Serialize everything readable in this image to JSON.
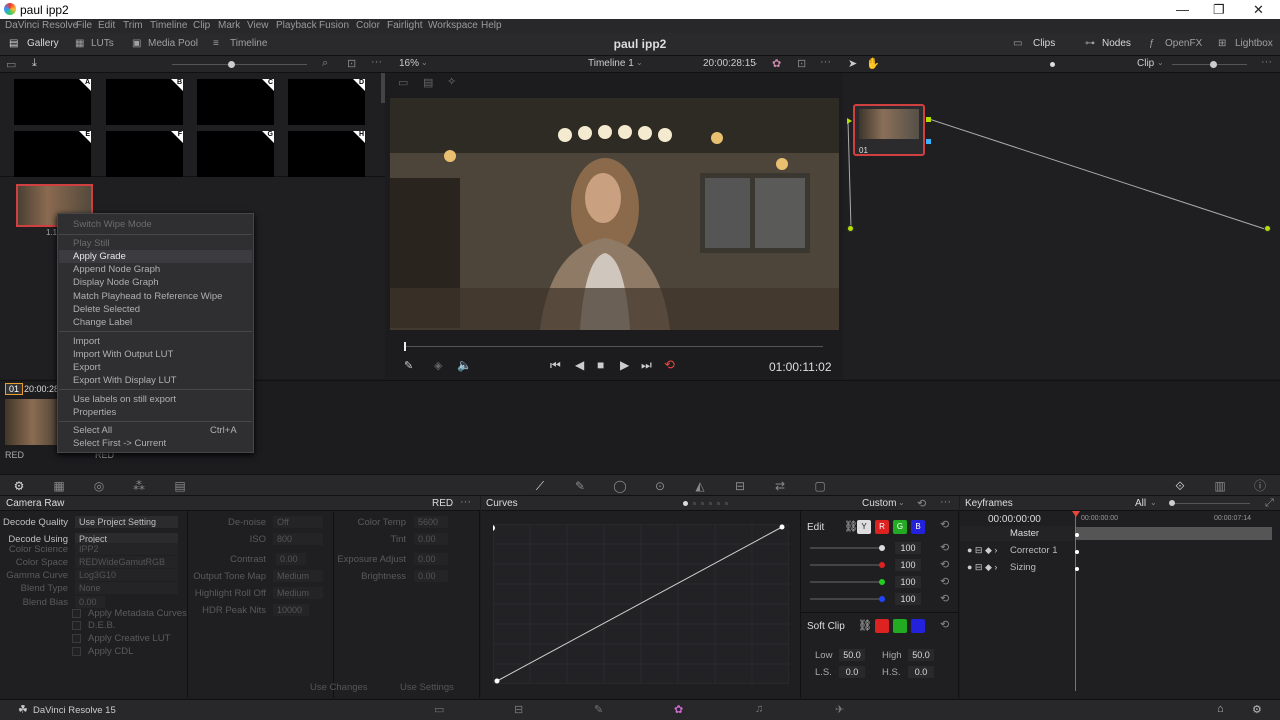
{
  "window": {
    "title": "paul ipp2",
    "min": "—",
    "max": "❐",
    "close": "✕"
  },
  "menu": [
    "DaVinci Resolve",
    "File",
    "Edit",
    "Trim",
    "Timeline",
    "Clip",
    "Mark",
    "View",
    "Playback",
    "Fusion",
    "Color",
    "Fairlight",
    "Workspace",
    "Help"
  ],
  "toolbar": {
    "gallery": "Gallery",
    "luts": "LUTs",
    "media_pool": "Media Pool",
    "timeline": "Timeline",
    "project_title": "paul ipp2",
    "clips": "Clips",
    "nodes": "Nodes",
    "openfx": "OpenFX",
    "lightbox": "Lightbox"
  },
  "bar2": {
    "zoom": "16%",
    "timeline_name": "Timeline 1",
    "timecode": "20:00:28:15",
    "clip_mode": "Clip"
  },
  "gallery": {
    "still_labels": [
      "A",
      "B",
      "C",
      "D",
      "E",
      "F",
      "G",
      "H"
    ],
    "still_id": "1.1"
  },
  "context_menu": {
    "items": [
      "Switch Wipe Mode",
      "Play Still",
      "Apply Grade",
      "Append Node Graph",
      "Display Node Graph",
      "Match Playhead to Reference Wipe",
      "Delete Selected",
      "Change Label",
      "Import",
      "Import With Output LUT",
      "Export",
      "Export With Display LUT",
      "Use labels on still export",
      "Properties",
      "Select All",
      "Select First -> Current"
    ],
    "shortcut_select_all": "Ctrl+A"
  },
  "viewer": {
    "timecode": "01:00:11:02"
  },
  "node": {
    "label": "01"
  },
  "clip_strip": {
    "clip_num": "01",
    "clip_tc": "20:00:28",
    "codec1": "RED",
    "codec2": "RED"
  },
  "camera_raw": {
    "title": "Camera Raw",
    "badge": "RED",
    "left": [
      {
        "label": "Decode Quality",
        "value": "Use Project Setting"
      },
      {
        "label": "Decode Using",
        "value": "Project"
      },
      {
        "label": "Color Science",
        "value": "IPP2"
      },
      {
        "label": "Color Space",
        "value": "REDWideGamutRGB"
      },
      {
        "label": "Gamma Curve",
        "value": "Log3G10"
      },
      {
        "label": "Blend Type",
        "value": "None"
      },
      {
        "label": "Blend Bias",
        "value": "0.00"
      }
    ],
    "checks": [
      "Apply Metadata Curves",
      "D.E.B.",
      "Apply Creative LUT",
      "Apply CDL"
    ],
    "mid": [
      {
        "label": "De-noise",
        "value": "Off"
      },
      {
        "label": "ISO",
        "value": "800"
      },
      {
        "label": "Contrast",
        "value": "0.00"
      },
      {
        "label": "Output Tone Map",
        "value": "Medium"
      },
      {
        "label": "Highlight Roll Off",
        "value": "Medium"
      },
      {
        "label": "HDR Peak Nits",
        "value": "10000"
      }
    ],
    "right": [
      {
        "label": "Color Temp",
        "value": "5600"
      },
      {
        "label": "Tint",
        "value": "0.00"
      },
      {
        "label": "Exposure Adjust",
        "value": "0.00"
      },
      {
        "label": "Brightness",
        "value": "0.00"
      }
    ],
    "use_changes": "Use Changes",
    "use_settings": "Use Settings"
  },
  "curves": {
    "title": "Curves",
    "mode": "Custom",
    "edit": "Edit",
    "channels": [
      "Y",
      "R",
      "G",
      "B"
    ],
    "values": [
      "100",
      "100",
      "100",
      "100"
    ],
    "soft_clip": "Soft Clip",
    "low_label": "Low",
    "low": "50.0",
    "high_label": "High",
    "high": "50.0",
    "ls_label": "L.S.",
    "ls": "0.0",
    "hs_label": "H.S.",
    "hs": "0.0"
  },
  "keyframes": {
    "title": "Keyframes",
    "filter": "All",
    "tc_start": "00:00:00:00",
    "ruler_start": "00:00:00:00",
    "ruler_end": "00:00:07:14",
    "tracks": [
      "Master",
      "Corrector 1",
      "Sizing"
    ]
  },
  "status": {
    "app": "DaVinci Resolve 15"
  },
  "colors": {
    "accent_red": "#e8463c",
    "selection": "#d04040",
    "node_green": "#b4e000"
  }
}
